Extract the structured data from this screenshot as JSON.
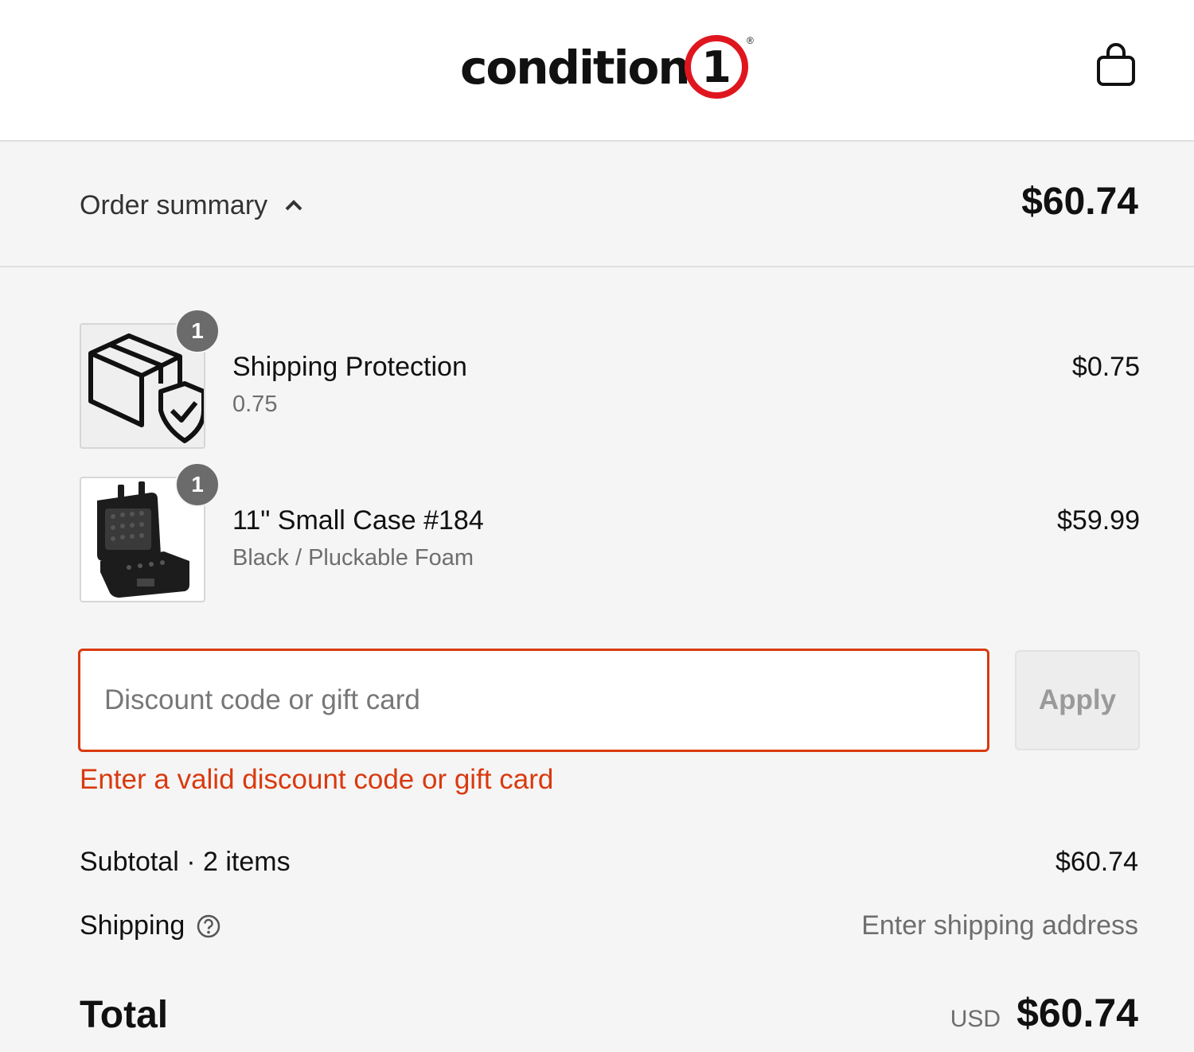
{
  "header": {
    "logo_text": "condition",
    "logo_number": "1",
    "logo_registered": "®",
    "cart_icon": "shopping-bag-icon"
  },
  "summary": {
    "label": "Order summary",
    "toggle_icon": "chevron-up-icon",
    "total": "$60.74"
  },
  "items": [
    {
      "quantity": "1",
      "name": "Shipping Protection",
      "variant": "0.75",
      "price": "$0.75",
      "thumbnail_icon": "box-shield-check-icon"
    },
    {
      "quantity": "1",
      "name": "11\" Small Case #184",
      "variant": "Black / Pluckable Foam",
      "price": "$59.99",
      "thumbnail_icon": "black-case-image"
    }
  ],
  "discount": {
    "placeholder": "Discount code or gift card",
    "value": "",
    "apply_label": "Apply",
    "error": "Enter a valid discount code or gift card"
  },
  "totals": {
    "subtotal_label": "Subtotal · 2 items",
    "subtotal_value": "$60.74",
    "shipping_label": "Shipping",
    "shipping_value": "Enter shipping address",
    "total_label": "Total",
    "currency": "USD",
    "total_value": "$60.74"
  },
  "colors": {
    "error": "#d93a0f",
    "logo_ring": "#e0161f",
    "background": "#f5f5f5"
  }
}
